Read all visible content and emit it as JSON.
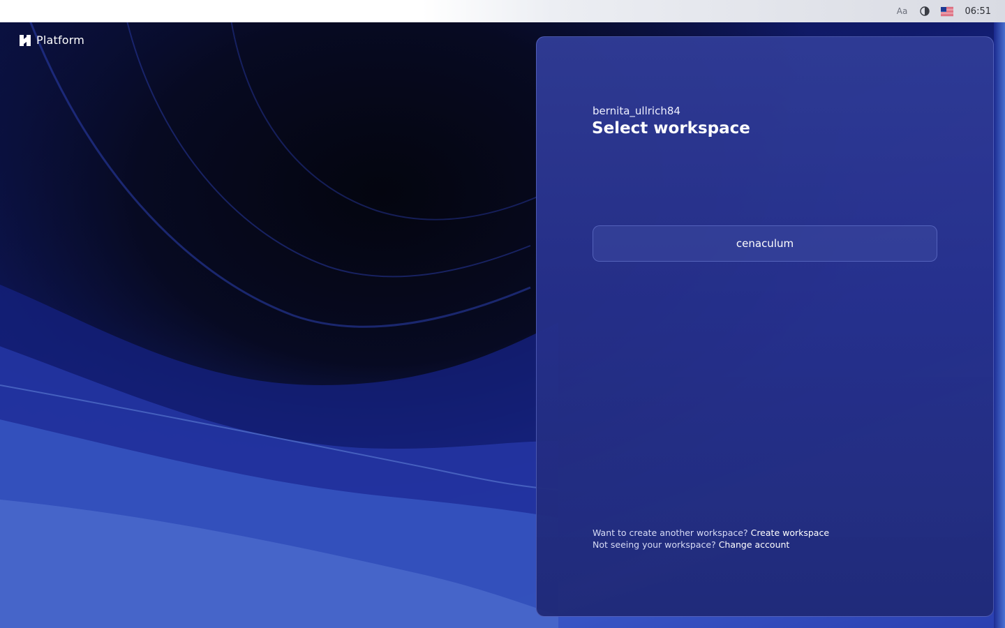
{
  "system_bar": {
    "font_button_label": "Aa",
    "contrast_icon": "contrast-icon",
    "language_icon": "us-flag-icon",
    "time": "06:51"
  },
  "brand": {
    "logo_icon": "platform-logo-icon",
    "name": "Platform"
  },
  "panel": {
    "username": "bernita_ullrich84",
    "title": "Select workspace",
    "workspaces": [
      {
        "name": "cenaculum"
      }
    ],
    "footer": {
      "create_prompt": "Want to create another workspace?",
      "create_link": "Create workspace",
      "change_prompt": "Not seeing your workspace?",
      "change_link": "Change account"
    }
  },
  "colors": {
    "panel_bg": "#2a3694",
    "accent_text": "#ffffff",
    "topbar_bg": "#ffffff"
  }
}
